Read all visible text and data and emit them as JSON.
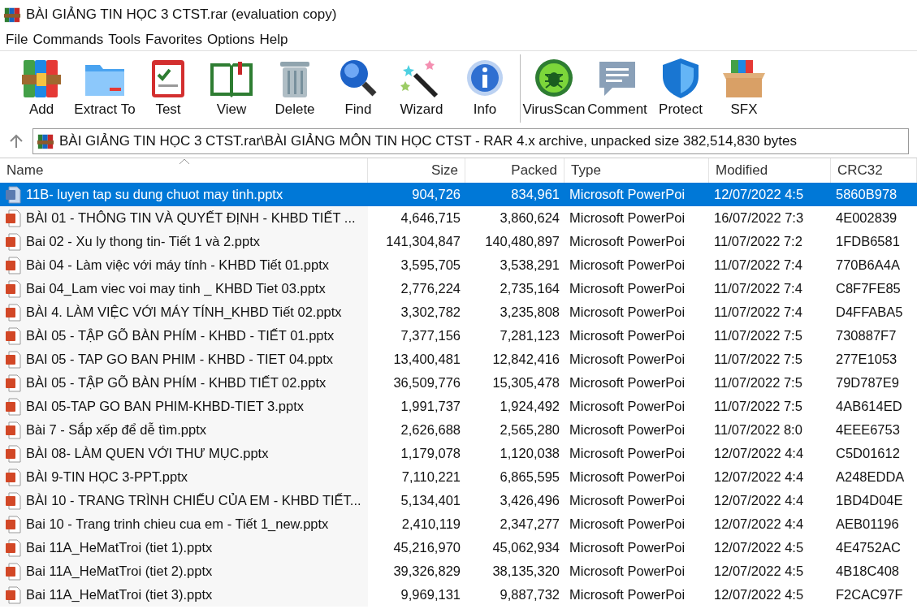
{
  "window": {
    "title": "BÀI GIẢNG TIN HỌC 3 CTST.rar (evaluation copy)"
  },
  "menu": [
    "File",
    "Commands",
    "Tools",
    "Favorites",
    "Options",
    "Help"
  ],
  "toolbar": [
    [
      {
        "kind": "add",
        "label": "Add"
      },
      {
        "kind": "extract",
        "label": "Extract To"
      },
      {
        "kind": "test",
        "label": "Test"
      },
      {
        "kind": "view",
        "label": "View"
      },
      {
        "kind": "delete",
        "label": "Delete"
      },
      {
        "kind": "find",
        "label": "Find"
      },
      {
        "kind": "wizard",
        "label": "Wizard"
      },
      {
        "kind": "info",
        "label": "Info"
      }
    ],
    [
      {
        "kind": "virus",
        "label": "VirusScan"
      },
      {
        "kind": "comment",
        "label": "Comment"
      },
      {
        "kind": "protect",
        "label": "Protect"
      },
      {
        "kind": "sfx",
        "label": "SFX"
      }
    ]
  ],
  "address": "BÀI GIẢNG TIN HỌC 3 CTST.rar\\BÀI GIẢNG MÔN TIN HỌC CTST - RAR 4.x archive, unpacked size 382,514,830 bytes",
  "table": {
    "columns": [
      "Name",
      "Size",
      "Packed",
      "Type",
      "Modified",
      "CRC32"
    ],
    "rows": [
      {
        "selected": true,
        "cells": [
          "11B- luyen tap su dung chuot may tinh.pptx",
          "904,726",
          "834,961",
          "Microsoft PowerPoi",
          "12/07/2022 4:5",
          "5860B978"
        ]
      },
      {
        "selected": false,
        "cells": [
          "BÀI 01 - THÔNG TIN VÀ QUYẾT ĐỊNH - KHBD TIẾT ...",
          "4,646,715",
          "3,860,624",
          "Microsoft PowerPoi",
          "16/07/2022 7:3",
          "4E002839"
        ]
      },
      {
        "selected": false,
        "cells": [
          "Bai 02 - Xu ly thong tin- Tiết 1 và 2.pptx",
          "141,304,847",
          "140,480,897",
          "Microsoft PowerPoi",
          "11/07/2022 7:2",
          "1FDB6581"
        ]
      },
      {
        "selected": false,
        "cells": [
          "Bài 04 - Làm việc với máy tính - KHBD Tiết 01.pptx",
          "3,595,705",
          "3,538,291",
          "Microsoft PowerPoi",
          "11/07/2022 7:4",
          "770B6A4A"
        ]
      },
      {
        "selected": false,
        "cells": [
          "Bai 04_Lam viec voi may tinh _ KHBD Tiet 03.pptx",
          "2,776,224",
          "2,735,164",
          "Microsoft PowerPoi",
          "11/07/2022 7:4",
          "C8F7FE85"
        ]
      },
      {
        "selected": false,
        "cells": [
          "BÀI 4. LÀM VIỆC VỚI MÁY TÍNH_KHBD Tiết 02.pptx",
          "3,302,782",
          "3,235,808",
          "Microsoft PowerPoi",
          "11/07/2022 7:4",
          "D4FFABA5"
        ]
      },
      {
        "selected": false,
        "cells": [
          "BÀI 05 - TẬP GÕ BÀN PHÍM - KHBD - TIẾT 01.pptx",
          "7,377,156",
          "7,281,123",
          "Microsoft PowerPoi",
          "11/07/2022 7:5",
          "730887F7"
        ]
      },
      {
        "selected": false,
        "cells": [
          "BAI 05 - TAP GO BAN PHIM - KHBD - TIET 04.pptx",
          "13,400,481",
          "12,842,416",
          "Microsoft PowerPoi",
          "11/07/2022 7:5",
          "277E1053"
        ]
      },
      {
        "selected": false,
        "cells": [
          "BÀI 05 - TẬP GÕ BÀN PHÍM - KHBD TIẾT 02.pptx",
          "36,509,776",
          "15,305,478",
          "Microsoft PowerPoi",
          "11/07/2022 7:5",
          "79D787E9"
        ]
      },
      {
        "selected": false,
        "cells": [
          "BAI 05-TAP GO BAN PHIM-KHBD-TIET 3.pptx",
          "1,991,737",
          "1,924,492",
          "Microsoft PowerPoi",
          "11/07/2022 7:5",
          "4AB614ED"
        ]
      },
      {
        "selected": false,
        "cells": [
          "Bài 7 - Sắp xếp để dễ tìm.pptx",
          "2,626,688",
          "2,565,280",
          "Microsoft PowerPoi",
          "11/07/2022 8:0",
          "4EEE6753"
        ]
      },
      {
        "selected": false,
        "cells": [
          "BÀI 08- LÀM QUEN VỚI THƯ MỤC.pptx",
          "1,179,078",
          "1,120,038",
          "Microsoft PowerPoi",
          "12/07/2022 4:4",
          "C5D01612"
        ]
      },
      {
        "selected": false,
        "cells": [
          "BÀI 9-TIN HỌC 3-PPT.pptx",
          "7,110,221",
          "6,865,595",
          "Microsoft PowerPoi",
          "12/07/2022 4:4",
          "A248EDDA"
        ]
      },
      {
        "selected": false,
        "cells": [
          "BÀI 10 - TRANG TRÌNH CHIẾU CỦA EM - KHBD TIẾT...",
          "5,134,401",
          "3,426,496",
          "Microsoft PowerPoi",
          "12/07/2022 4:4",
          "1BD4D04E"
        ]
      },
      {
        "selected": false,
        "cells": [
          "Bai 10 - Trang trinh chieu cua em - Tiết 1_new.pptx",
          "2,410,119",
          "2,347,277",
          "Microsoft PowerPoi",
          "12/07/2022 4:4",
          "AEB01196"
        ]
      },
      {
        "selected": false,
        "cells": [
          "Bai 11A_HeMatTroi (tiet 1).pptx",
          "45,216,970",
          "45,062,934",
          "Microsoft PowerPoi",
          "12/07/2022 4:5",
          "4E4752AC"
        ]
      },
      {
        "selected": false,
        "cells": [
          "Bai 11A_HeMatTroi (tiet 2).pptx",
          "39,326,829",
          "38,135,320",
          "Microsoft PowerPoi",
          "12/07/2022 4:5",
          "4B18C408"
        ]
      },
      {
        "selected": false,
        "cells": [
          "Bai 11A_HeMatTroi (tiet 3).pptx",
          "9,969,131",
          "9,887,732",
          "Microsoft PowerPoi",
          "12/07/2022 4:5",
          "F2CAC97F"
        ]
      }
    ]
  }
}
